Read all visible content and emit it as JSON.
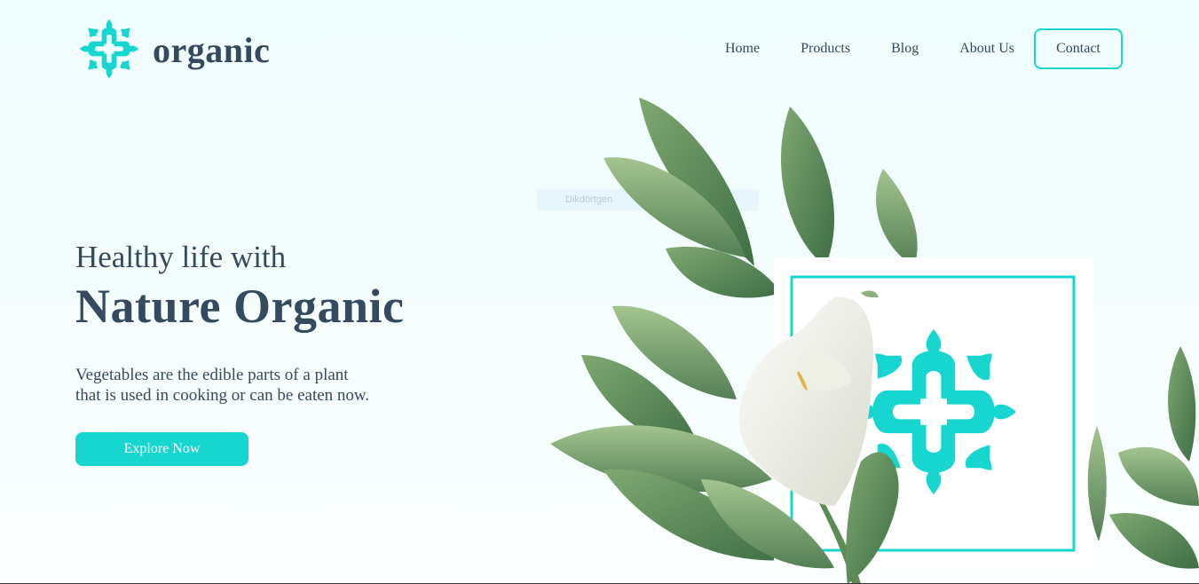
{
  "brand": {
    "name": "organic",
    "logo_icon": "mandala-logo-icon",
    "accent_color": "#16d6cf",
    "text_color": "#344a5e"
  },
  "nav": {
    "items": [
      {
        "label": "Home"
      },
      {
        "label": "Products"
      },
      {
        "label": "Blog"
      },
      {
        "label": "About Us"
      }
    ],
    "contact_label": "Contact"
  },
  "hero": {
    "subtitle": "Healthy life with",
    "title": "Nature Organic",
    "description_line1": "Vegetables are the edible parts of a plant",
    "description_line2": "that is used in cooking or can be eaten now.",
    "cta_label": "Explore Now"
  },
  "overlay": {
    "ghost_text": "Dikdörtgen"
  },
  "illustration": {
    "name": "calla-lily-leaves-with-logo-frame"
  }
}
